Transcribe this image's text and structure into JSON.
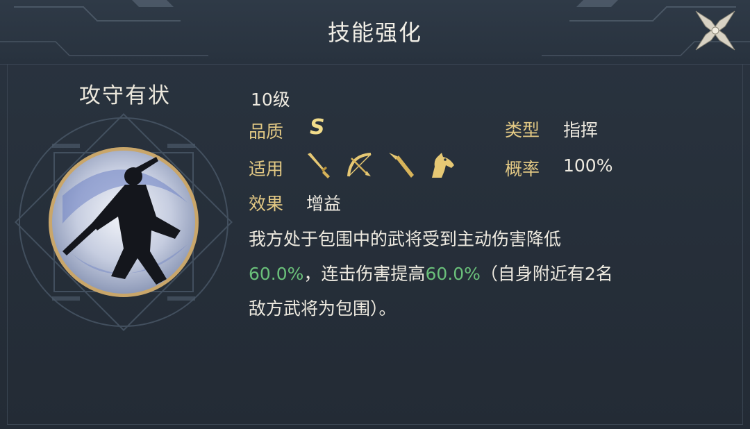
{
  "window": {
    "title": "技能强化"
  },
  "skill": {
    "name": "攻守有状",
    "level": "10级",
    "quality_label": "品质",
    "quality_value": "S",
    "type_label": "类型",
    "type_value": "指挥",
    "applicable_label": "适用",
    "applicable_icons": [
      "sword-icon",
      "bow-icon",
      "spear-icon",
      "horse-icon"
    ],
    "rate_label": "概率",
    "rate_value": "100%",
    "effect_label": "效果",
    "effect_value": "增益",
    "description": {
      "line1": "我方处于包围中的武将受到主动伤害降低",
      "val1": "60.0%",
      "mid": "，连击伤害提高",
      "val2": "60.0%",
      "tail": "（自身附近有2名",
      "line3": "敌方武将为包围）。"
    }
  },
  "colors": {
    "label_gold": "#e3c984",
    "value_green": "#6ac07a",
    "text_light": "#eeeae0",
    "background": "#27303b"
  }
}
